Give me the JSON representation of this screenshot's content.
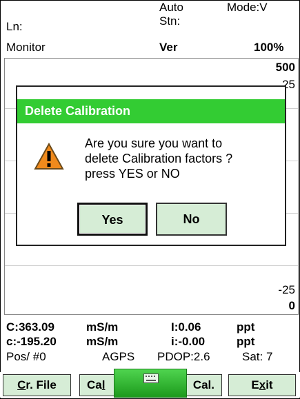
{
  "header": {
    "auto": "Auto",
    "mode": "Mode:V",
    "line": "Ln:",
    "station": "Stn:",
    "monitor": "Monitor",
    "ver": "Ver",
    "percent": "100%"
  },
  "plot": {
    "scale_top": "500",
    "scale_upper": "25",
    "scale_lower": "-25",
    "scale_bottom": "0"
  },
  "dialog": {
    "title": "Delete Calibration",
    "message": "Are you sure you want to\ndelete Calibration factors ?\npress  YES  or  NO",
    "yes": "Yes",
    "no": "No"
  },
  "status": {
    "c_upper_val": "C:363.09",
    "c_upper_unit": "mS/m",
    "i_upper_val": "I:0.06",
    "i_upper_unit": "ppt",
    "c_lower_val": "c:-195.20",
    "c_lower_unit": "mS/m",
    "i_lower_val": "i:-0.00",
    "i_lower_unit": "ppt",
    "pos": "Pos/ #0",
    "agps": "AGPS",
    "pdop": "PDOP:2.6",
    "sat": "Sat: 7"
  },
  "toolbar": {
    "cr_file_prefix": "C",
    "cr_file_rest": "r. File",
    "cal_left_prefix": "Ca",
    "cal_left_rest": "l",
    "cal_right": "Cal.",
    "exit_prefix": "E",
    "exit_u": "x",
    "exit_rest": "it"
  },
  "colors": {
    "title_bar": "#33cc33",
    "button_bg": "#d6edd6",
    "warning": "#f08a1c"
  },
  "icons": {
    "warning": "warning-icon",
    "keyboard": "keyboard-icon"
  }
}
